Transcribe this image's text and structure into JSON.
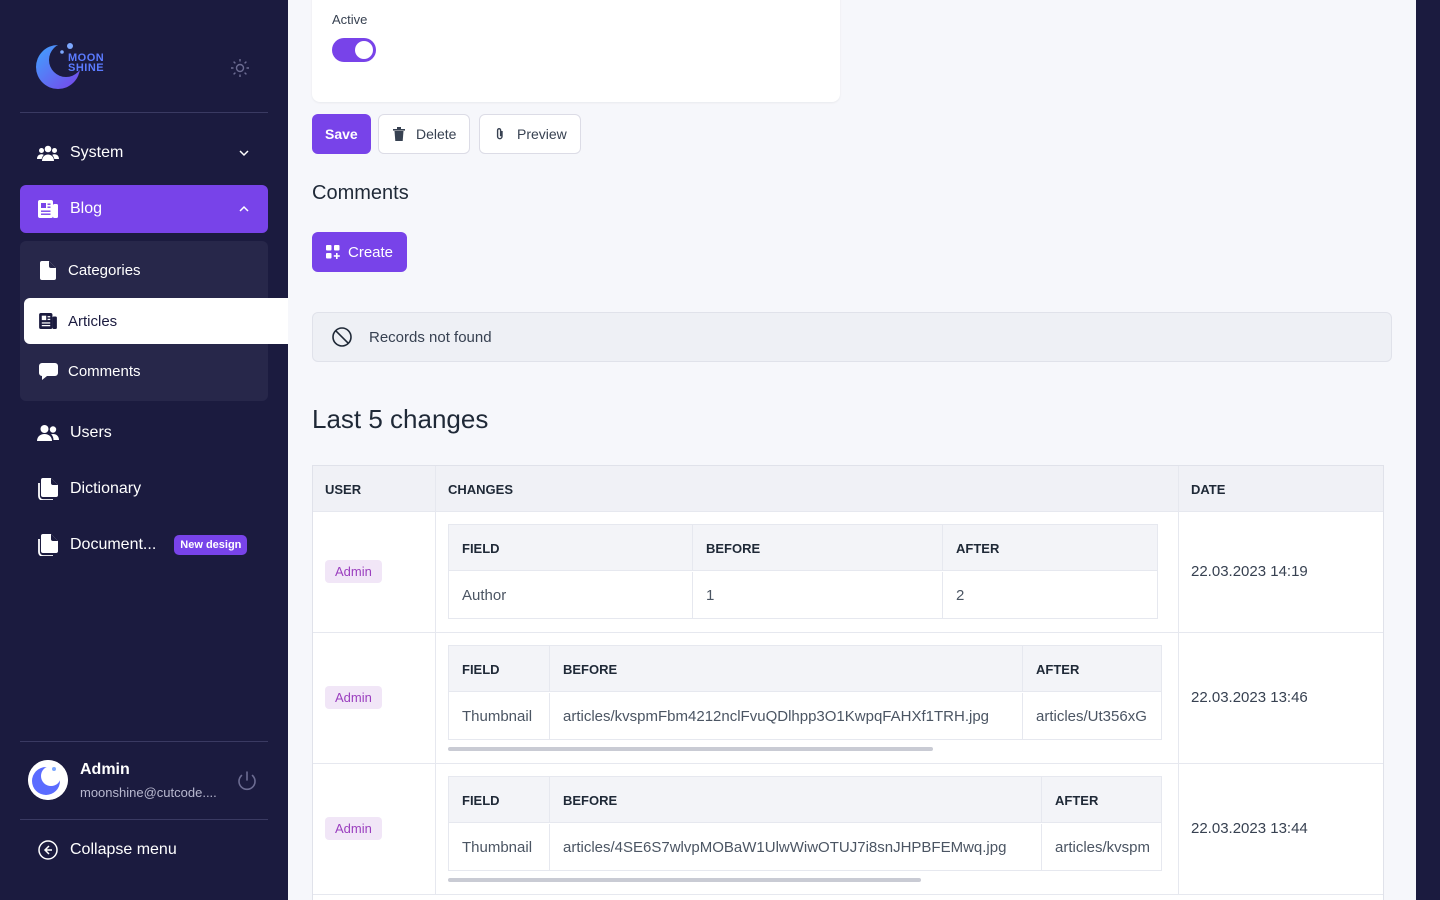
{
  "brand": {
    "logo_line1": "MOON",
    "logo_line2": "SHINE"
  },
  "sidebar": {
    "items": [
      {
        "label": "System",
        "icon": "users-group-icon"
      },
      {
        "label": "Blog",
        "icon": "newspaper-icon",
        "active": true
      },
      {
        "label": "Users",
        "icon": "users-icon"
      },
      {
        "label": "Dictionary",
        "icon": "documents-icon"
      },
      {
        "label": "Document...",
        "icon": "documents-icon",
        "badge": "New design"
      }
    ],
    "blog_sub": [
      {
        "label": "Categories",
        "icon": "file-icon"
      },
      {
        "label": "Articles",
        "icon": "newspaper-icon",
        "current": true
      },
      {
        "label": "Comments",
        "icon": "chat-icon"
      }
    ],
    "profile": {
      "name": "Admin",
      "email": "moonshine@cutcode...."
    },
    "collapse_label": "Collapse menu"
  },
  "form": {
    "active_label": "Active",
    "active_value": true,
    "buttons": {
      "save": "Save",
      "delete": "Delete",
      "preview": "Preview"
    }
  },
  "comments": {
    "title": "Comments",
    "create_label": "Create",
    "empty_message": "Records not found"
  },
  "changes": {
    "title": "Last 5 changes",
    "headers": {
      "user": "USER",
      "changes": "CHANGES",
      "date": "DATE"
    },
    "inner_headers": {
      "field": "FIELD",
      "before": "BEFORE",
      "after": "AFTER"
    },
    "rows": [
      {
        "user": "Admin",
        "field": "Author",
        "before": "1",
        "after": "2",
        "date": "22.03.2023 14:19"
      },
      {
        "user": "Admin",
        "field": "Thumbnail",
        "before": "articles/kvspmFbm4212nclFvuQDlhpp3O1KwpqFAHXf1TRH.jpg",
        "after": "articles/Ut356xG",
        "date": "22.03.2023 13:46"
      },
      {
        "user": "Admin",
        "field": "Thumbnail",
        "before": "articles/4SE6S7wlvpMOBaW1UlwWiwOTUJ7i8snJHPBFEMwq.jpg",
        "after": "articles/kvspm",
        "date": "22.03.2023 13:44"
      }
    ]
  },
  "colors": {
    "accent": "#7843e9",
    "sidebar_bg": "#1b1b3f",
    "main_bg": "#f6f7fb"
  }
}
